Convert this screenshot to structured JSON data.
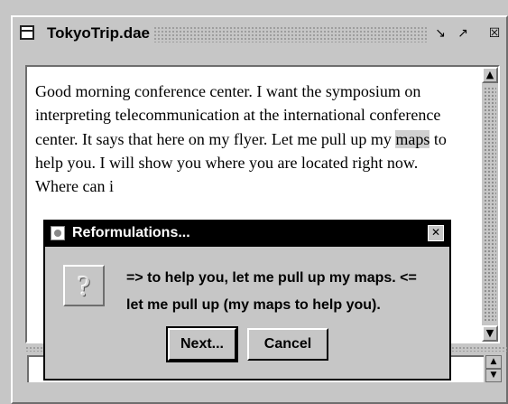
{
  "window": {
    "title": "TokyoTrip.dae",
    "icon": "document-icon",
    "controls": [
      "minimize-icon",
      "maximize-icon",
      "close-icon"
    ]
  },
  "document": {
    "text_before": "Good morning conference center. I want the symposium on interpreting telecommunication at the international conference center. It says that here on my flyer. Let me pull up my ",
    "highlight": "maps",
    "text_after": " to help you. I will show you where you are located right now. Where can i"
  },
  "dialog": {
    "title": "Reformulations...",
    "icon": "question-icon",
    "line1": "=> to help you, let me pull up my maps. <=",
    "line2": "let me pull up (my maps to help you).",
    "next_label": "Next...",
    "cancel_label": "Cancel"
  },
  "colors": {
    "background": "#c6c6c6",
    "dialog_title_bg": "#000000",
    "highlight_bg": "#d0d0d0"
  }
}
